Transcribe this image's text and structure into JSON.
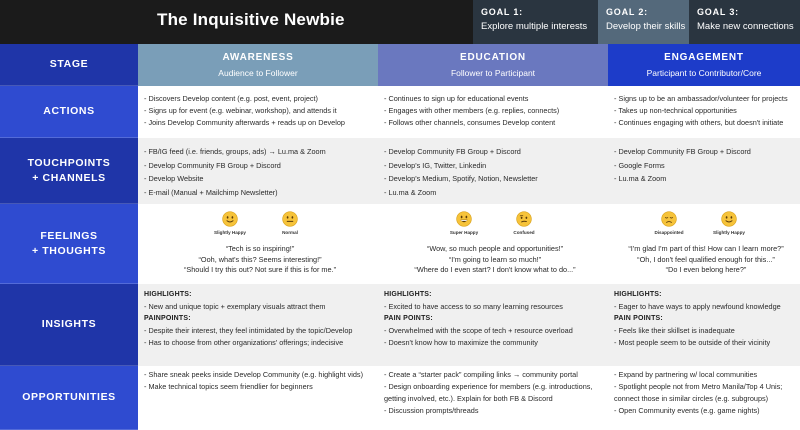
{
  "title": "The Inquisitive Newbie",
  "goals": [
    {
      "label": "GOAL 1:",
      "text": "Explore multiple interests"
    },
    {
      "label": "GOAL 2:",
      "text": "Develop their skills"
    },
    {
      "label": "GOAL 3:",
      "text": "Make new connections"
    }
  ],
  "rows": {
    "stage": "STAGE",
    "actions": "ACTIONS",
    "touchpoints_1": "TOUCHPOINTS",
    "touchpoints_2": "+ CHANNELS",
    "feelings_1": "FEELINGS",
    "feelings_2": "+ THOUGHTS",
    "insights": "INSIGHTS",
    "opportunities": "OPPORTUNITIES"
  },
  "stages": [
    {
      "title": "AWARENESS",
      "sub": "Audience to Follower"
    },
    {
      "title": "EDUCATION",
      "sub": "Follower to Participant"
    },
    {
      "title": "ENGAGEMENT",
      "sub": "Participant to Contributor/Core"
    }
  ],
  "actions": [
    [
      "- Discovers Develop content (e.g. post, event, project)",
      "- Signs up for event (e.g. webinar, workshop), and attends it",
      "- Joins Develop Community afterwards + reads up on Develop"
    ],
    [
      "- Continues to sign up for educational events",
      "- Engages with other members (e.g. replies, connects)",
      "- Follows other channels, consumes Develop content"
    ],
    [
      "- Signs up to be an ambassador/volunteer for projects",
      "- Takes up non-technical opportunities",
      "- Continues engaging with others, but doesn't initiate"
    ]
  ],
  "touchpoints": [
    [
      "- FB/IG feed (i.e. friends, groups, ads) → Lu.ma & Zoom",
      "- Develop Community FB Group + Discord",
      "- Develop Website",
      "- E-mail (Manual + Mailchimp Newsletter)"
    ],
    [
      "- Develop Community FB Group + Discord",
      "- Develop's IG, Twitter, Linkedin",
      "- Develop's Medium, Spotify, Notion, Newsletter",
      "- Lu.ma & Zoom"
    ],
    [
      "- Develop Community FB Group +  Discord",
      "- Google Forms",
      "- Lu.ma & Zoom"
    ]
  ],
  "feelings": [
    {
      "faces": [
        {
          "label": "Slightly Happy",
          "icon": "slightly-happy"
        },
        {
          "label": "Normal",
          "icon": "neutral"
        }
      ],
      "quotes": [
        "“Tech is so inspiring!”",
        "“Ooh, what's this? Seems interesting!”",
        "“Should I try this out? Not sure if this is for me.”"
      ]
    },
    {
      "faces": [
        {
          "label": "Super Happy",
          "icon": "grinning"
        },
        {
          "label": "Confused",
          "icon": "confused"
        }
      ],
      "quotes": [
        "“Wow, so much people and opportunities!”",
        "“I'm going to learn so much!”",
        "“Where do I even start? I don't know what to do...”"
      ]
    },
    {
      "faces": [
        {
          "label": "Disappointed",
          "icon": "disappointed"
        },
        {
          "label": "Slightly Happy",
          "icon": "slightly-happy"
        }
      ],
      "quotes": [
        "“I'm glad I'm part of this! How can I learn more?”",
        "“Oh, I don't feel qualified enough for this...”",
        "“Do I even belong here?”"
      ]
    }
  ],
  "insights": [
    {
      "highlights_label": "HIGHLIGHTS:",
      "highlights": [
        "- New and unique topic + exemplary visuals attract them"
      ],
      "pain_label": "PAINPOINTS:",
      "pain": [
        "- Despite their interest, they feel intimidated by the topic/Develop",
        "- Has to choose from other organizations' offerings; indecisive"
      ]
    },
    {
      "highlights_label": "HIGHLIGHTS:",
      "highlights": [
        "- Excited to have access to so many learning resources"
      ],
      "pain_label": "PAIN POINTS:",
      "pain": [
        "- Overwhelmed with the scope of tech + resource overload",
        "- Doesn't know how to maximize the community"
      ]
    },
    {
      "highlights_label": "HIGHLIGHTS:",
      "highlights": [
        "- Eager to have ways to apply newfound knowledge"
      ],
      "pain_label": "PAIN POINTS:",
      "pain": [
        "- Feels like their skillset is inadequate",
        "- Most people seem to be outside of their vicinity"
      ]
    }
  ],
  "opportunities": [
    [
      "- Share sneak peeks inside Develop Community (e.g. highlight vids)",
      "- Make technical topics seem friendlier for beginners"
    ],
    [
      "- Create a “starter pack” compiling links → community portal",
      "- Design onboarding experience for members (e.g. introductions,",
      "getting involved, etc.). Explain for both FB & Discord",
      "- Discussion prompts/threads"
    ],
    [
      "- Expand by partnering w/ local communities",
      "- Spotlight people not from Metro Manila/Top 4 Unis;",
      "connect those in similar circles (e.g. subgroups)",
      "- Open Community events (e.g. game nights)"
    ]
  ],
  "colors": {
    "title_bar": "#1b1b1b",
    "goal_dark": "#2a3540",
    "goal_highlight": "#54697b",
    "row_header_dark": "#1f35a8",
    "row_header_mid": "#2f4bd0",
    "awareness": "#7a9eb8",
    "education": "#6a78bf",
    "engagement": "#1d3cc9",
    "emoji": "#f6c33a"
  }
}
